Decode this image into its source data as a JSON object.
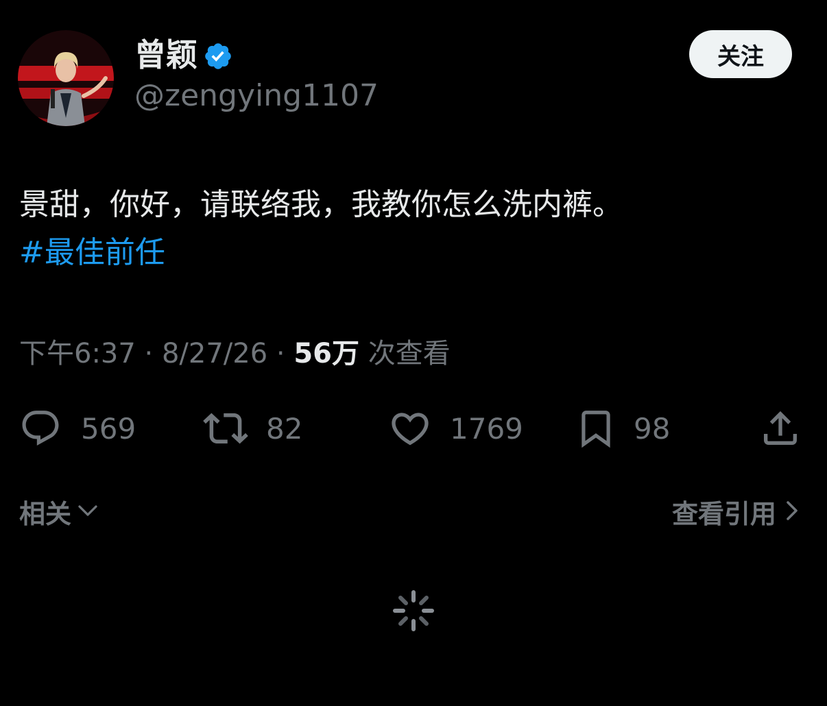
{
  "author": {
    "display_name": "曾颖",
    "handle": "@zengying1107",
    "verified_icon": "verified-badge-icon",
    "verified_color": "#1d9bf0"
  },
  "follow_button": {
    "label": "关注"
  },
  "tweet": {
    "text": "景甜，你好，请联络我，我教你怎么洗内裤。",
    "hashtag": "#最佳前任"
  },
  "meta": {
    "time": "下午6:37",
    "separator": "·",
    "date": "8/27/26",
    "views_count": "56万",
    "views_label": "次查看"
  },
  "actions": {
    "reply": {
      "icon": "reply-icon",
      "count": "569"
    },
    "retweet": {
      "icon": "retweet-icon",
      "count": "82"
    },
    "like": {
      "icon": "heart-icon",
      "count": "1769"
    },
    "bookmark": {
      "icon": "bookmark-icon",
      "count": "98"
    },
    "share": {
      "icon": "share-icon"
    }
  },
  "footer": {
    "related_label": "相关",
    "quotes_label": "查看引用"
  },
  "colors": {
    "background": "#000000",
    "text_primary": "#e7e9ea",
    "text_secondary": "#71767b",
    "accent": "#1d9bf0",
    "button_bg": "#eff3f4"
  }
}
